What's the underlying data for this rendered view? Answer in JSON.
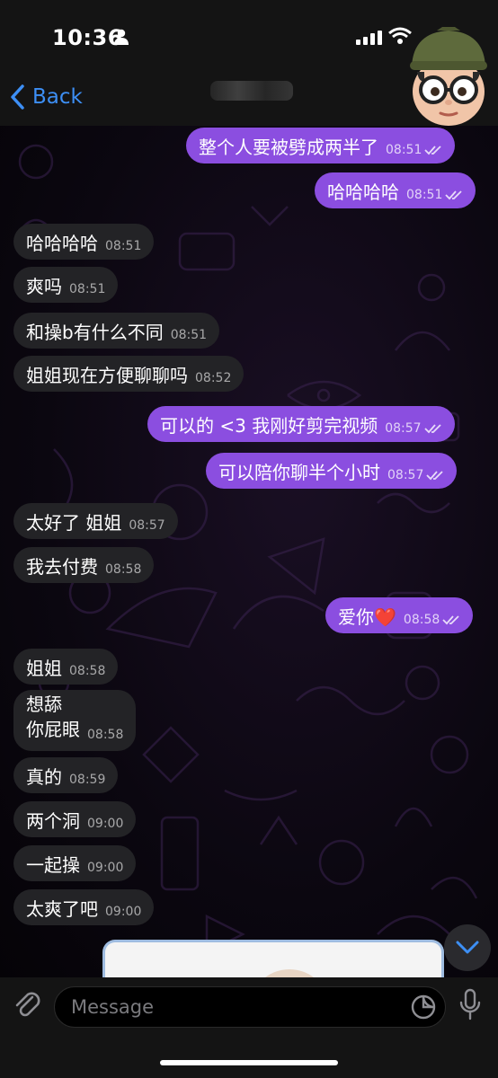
{
  "status_bar": {
    "time": "10:36"
  },
  "header": {
    "back_label": "Back"
  },
  "messages": [
    {
      "dir": "out",
      "text": "整个人要被劈成两半了",
      "time": "08:51",
      "read": true
    },
    {
      "dir": "out",
      "text": "哈哈哈哈",
      "time": "08:51",
      "read": true
    },
    {
      "dir": "in",
      "text": "哈哈哈哈",
      "time": "08:51"
    },
    {
      "dir": "in",
      "text": "爽吗",
      "time": "08:51"
    },
    {
      "dir": "in",
      "text": "和操b有什么不同",
      "time": "08:51"
    },
    {
      "dir": "in",
      "text": "姐姐现在方便聊聊吗",
      "time": "08:52"
    },
    {
      "dir": "out",
      "text": "可以的 <3 我刚好剪完视频",
      "time": "08:57",
      "read": true
    },
    {
      "dir": "out",
      "text": "可以陪你聊半个小时",
      "time": "08:57",
      "read": true
    },
    {
      "dir": "in",
      "text": "太好了 姐姐",
      "time": "08:57"
    },
    {
      "dir": "in",
      "text": "我去付费",
      "time": "08:58"
    },
    {
      "dir": "out",
      "text": "爱你❤️",
      "time": "08:58",
      "read": true
    },
    {
      "dir": "in",
      "text": "姐姐",
      "time": "08:58"
    },
    {
      "dir": "in",
      "text_line1": "想舔",
      "text_line2": "你屁眼",
      "time": "08:58"
    },
    {
      "dir": "in",
      "text": "真的",
      "time": "08:59"
    },
    {
      "dir": "in",
      "text": "两个洞",
      "time": "09:00"
    },
    {
      "dir": "in",
      "text": "一起操",
      "time": "09:00"
    },
    {
      "dir": "in",
      "text": "太爽了吧",
      "time": "09:00"
    }
  ],
  "composer": {
    "placeholder": "Message"
  },
  "icons": {
    "back": "chevron-left-icon",
    "attach": "paperclip-icon",
    "sticker": "sticker-icon",
    "mic": "microphone-icon",
    "scroll": "chevron-down-icon",
    "read": "double-check-icon"
  },
  "colors": {
    "outgoing": "#8b4ee0",
    "incoming": "#232326",
    "accent": "#3d8ff5"
  }
}
